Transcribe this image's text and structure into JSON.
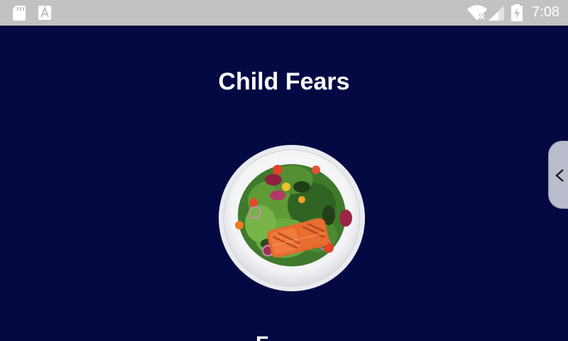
{
  "status_bar": {
    "time": "7:08",
    "icons": [
      "sd-card-icon",
      "keyboard-a-icon",
      "wifi-off-icon",
      "signal-icon",
      "battery-charging-icon"
    ]
  },
  "main": {
    "title": "Child Fears",
    "image_alt": "salad-with-salmon-plate",
    "next_section_heading": "F"
  },
  "drawer_handle": {
    "icon": "chevron-left-icon"
  },
  "colors": {
    "background": "#040944",
    "status_bar": "#c2c2c2",
    "text": "#ffffff",
    "handle": "#b9bdcc"
  }
}
